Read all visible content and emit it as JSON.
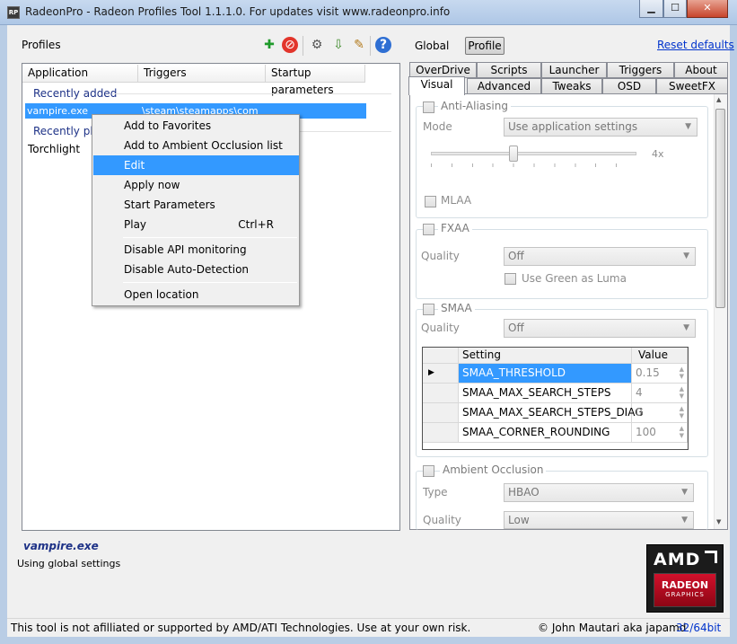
{
  "window": {
    "icon_text": "RP",
    "title": "RadeonPro - Radeon Profiles Tool 1.1.1.0. For updates visit www.radeonpro.info",
    "minimize": "▁",
    "maximize": "☐",
    "close": "✕"
  },
  "left": {
    "profiles_label": "Profiles",
    "toolbar_icons": [
      "add-profile-icon",
      "delete-profile-icon",
      "settings-icon",
      "import-icon",
      "clean-icon",
      "help-icon"
    ],
    "toolbar_glyphs": [
      "✚",
      "⊘",
      "⚙",
      "⇩",
      "✎",
      "?"
    ],
    "columns": [
      "Application",
      "Triggers",
      "Startup parameters"
    ],
    "group_recently_added": "Recently added",
    "group_recently_played": "Recently pla",
    "selected_row": {
      "app": "vampire.exe",
      "trigger": "\\steam\\steamapps\\com"
    },
    "played_row": {
      "app": "Torchlight"
    }
  },
  "context_menu": {
    "items": [
      {
        "label": "Add to Favorites",
        "shortcut": ""
      },
      {
        "label": "Add to Ambient Occlusion list",
        "shortcut": ""
      },
      {
        "label": "Edit",
        "shortcut": ""
      },
      {
        "label": "Apply now",
        "shortcut": ""
      },
      {
        "label": "Start Parameters",
        "shortcut": ""
      },
      {
        "label": "Play",
        "shortcut": "Ctrl+R"
      },
      {
        "label": "Disable API monitoring",
        "shortcut": ""
      },
      {
        "label": "Disable Auto-Detection",
        "shortcut": ""
      },
      {
        "label": "Open location",
        "shortcut": ""
      }
    ]
  },
  "right": {
    "global_label": "Global",
    "profile_label": "Profile",
    "reset_link": "Reset defaults",
    "tabs_row1": [
      "OverDrive",
      "Scripts",
      "Launcher",
      "Triggers",
      "About"
    ],
    "tabs_row2": [
      "Visual",
      "Advanced",
      "Tweaks",
      "OSD",
      "SweetFX"
    ],
    "anti_aliasing": {
      "title": "Anti-Aliasing",
      "mode_label": "Mode",
      "mode_value": "Use application settings",
      "slider_value": "4x",
      "mlaa_label": "MLAA"
    },
    "fxaa": {
      "title": "FXAA",
      "quality_label": "Quality",
      "quality_value": "Off",
      "green_luma_label": "Use Green as Luma"
    },
    "smaa": {
      "title": "SMAA",
      "quality_label": "Quality",
      "quality_value": "Off",
      "grid_headers": [
        "Setting",
        "Value"
      ],
      "grid_rows": [
        {
          "setting": "SMAA_THRESHOLD",
          "value": "0.15"
        },
        {
          "setting": "SMAA_MAX_SEARCH_STEPS",
          "value": "4"
        },
        {
          "setting": "SMAA_MAX_SEARCH_STEPS_DIAG",
          "value": "0"
        },
        {
          "setting": "SMAA_CORNER_ROUNDING",
          "value": "100"
        }
      ]
    },
    "ambient_occlusion": {
      "title": "Ambient Occlusion",
      "type_label": "Type",
      "type_value": "HBAO",
      "quality_label": "Quality",
      "quality_value": "Low"
    }
  },
  "bottom": {
    "profile_name": "vampire.exe",
    "profile_status": "Using global settings",
    "logo_brand": "AMD",
    "logo_line1": "RADEON",
    "logo_line2": "GRAPHICS",
    "disclaimer": "This tool is not afilliated or supported by AMD/ATI Technologies. Use at your own risk.",
    "author": "© John Mautari aka japamd",
    "bitness": "32/64bit"
  },
  "colors": {
    "selection": "#3399ff",
    "link": "#0033cc",
    "profile_name": "#1e3287"
  }
}
